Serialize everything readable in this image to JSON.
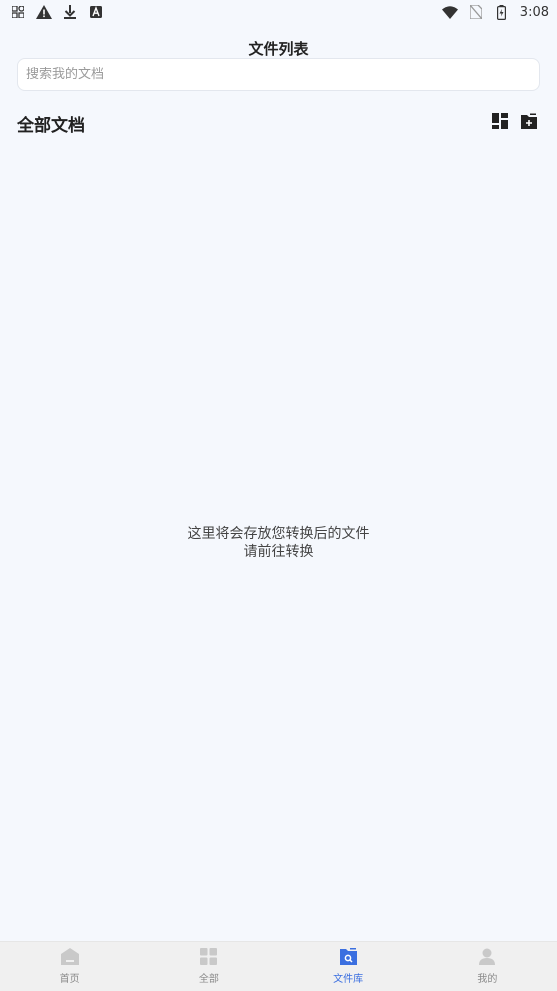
{
  "status_bar": {
    "time": "3:08",
    "left_icons": [
      "apps-icon",
      "warning-icon",
      "download-icon",
      "text-a-icon"
    ],
    "right_icons": [
      "wifi-icon",
      "no-sim-icon",
      "battery-charging-icon"
    ]
  },
  "header": {
    "title": "文件列表"
  },
  "search": {
    "placeholder": "搜索我的文档",
    "value": ""
  },
  "section": {
    "title": "全部文档",
    "actions": [
      "layout-grid-icon",
      "new-folder-icon"
    ]
  },
  "empty_state": {
    "line1": "这里将会存放您转换后的文件",
    "line2": "请前往转换"
  },
  "tabs": [
    {
      "label": "首页",
      "icon": "home-icon",
      "active": false
    },
    {
      "label": "全部",
      "icon": "grid-icon",
      "active": false
    },
    {
      "label": "文件库",
      "icon": "file-library-icon",
      "active": true
    },
    {
      "label": "我的",
      "icon": "profile-icon",
      "active": false
    }
  ],
  "colors": {
    "background": "#f5f8fd",
    "accent": "#3b6fe0",
    "tab_inactive": "#8a8a8a",
    "tab_bar": "#f0f0f0"
  }
}
